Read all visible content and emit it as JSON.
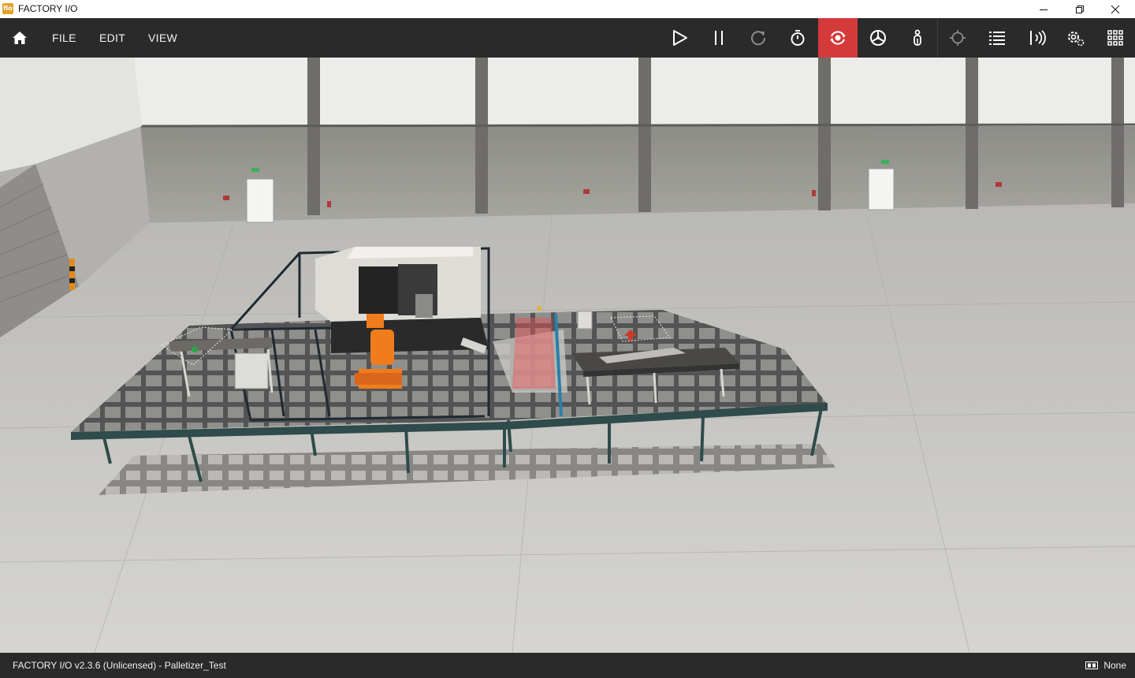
{
  "window": {
    "title": "FACTORY I/O",
    "logo_text": "fio",
    "controls": [
      "minimize",
      "restore",
      "close"
    ]
  },
  "menu": {
    "items": [
      "FILE",
      "EDIT",
      "VIEW"
    ]
  },
  "toolbar": {
    "tools": [
      {
        "name": "play",
        "icon": "play-icon"
      },
      {
        "name": "pause",
        "icon": "pause-icon"
      },
      {
        "name": "reset",
        "icon": "reset-icon"
      },
      {
        "name": "timer",
        "icon": "timer-icon"
      },
      {
        "name": "orbit-camera",
        "icon": "orbit-camera-icon",
        "active": true
      },
      {
        "name": "fly-camera",
        "icon": "fly-camera-icon"
      },
      {
        "name": "first-person",
        "icon": "first-person-icon"
      },
      {
        "name": "pick",
        "icon": "crosshair-icon"
      },
      {
        "name": "parts-list",
        "icon": "list-icon"
      },
      {
        "name": "sensors",
        "icon": "sensor-icon"
      },
      {
        "name": "settings",
        "icon": "settings-icon"
      },
      {
        "name": "drivers",
        "icon": "grid-icon"
      }
    ],
    "active_color": "#d43a3a"
  },
  "status": {
    "text": "FACTORY I/O v2.3.6 (Unlicensed)  - Palletizer_Test",
    "driver_label": "None"
  }
}
